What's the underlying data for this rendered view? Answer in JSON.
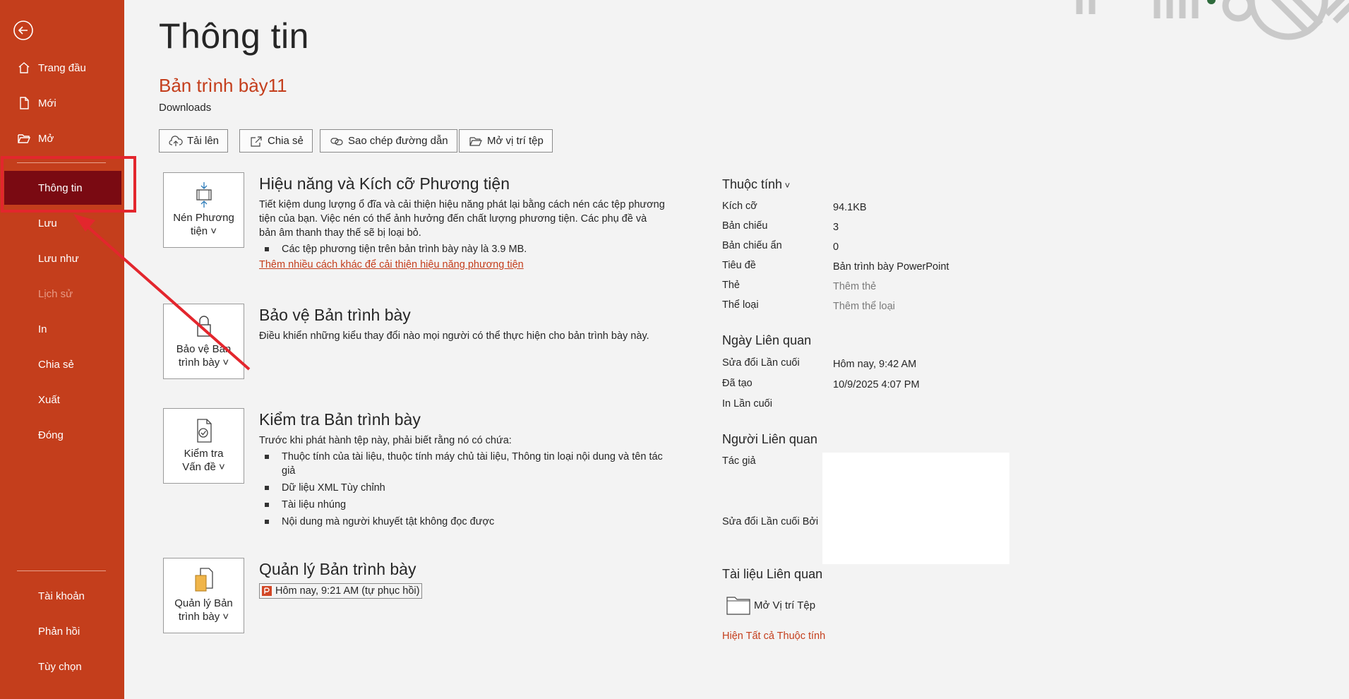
{
  "colors": {
    "sidebar": "#c43e1c",
    "sidebar_active": "#7a0a12",
    "accent": "#c43e1c",
    "highlight": "#e3262d"
  },
  "sidebar": {
    "items": [
      {
        "label": "Trang đầu",
        "icon": "home-icon"
      },
      {
        "label": "Mới",
        "icon": "new-document-icon"
      },
      {
        "label": "Mở",
        "icon": "open-folder-icon"
      },
      {
        "label": "Thông tin",
        "active": true
      },
      {
        "label": "Lưu"
      },
      {
        "label": "Lưu như"
      },
      {
        "label": "Lịch sử",
        "disabled": true
      },
      {
        "label": "In"
      },
      {
        "label": "Chia sẻ"
      },
      {
        "label": "Xuất"
      },
      {
        "label": "Đóng"
      }
    ],
    "bottom": [
      {
        "label": "Tài khoản"
      },
      {
        "label": "Phản hồi"
      },
      {
        "label": "Tùy chọn"
      }
    ]
  },
  "header": {
    "title": "Thông tin",
    "doc_title": "Bản trình bày11",
    "location": "Downloads"
  },
  "actions": [
    {
      "label": "Tải lên",
      "icon": "upload-cloud-icon"
    },
    {
      "label": "Chia sẻ",
      "icon": "share-icon"
    },
    {
      "label": "Sao chép đường dẫn",
      "icon": "link-icon"
    },
    {
      "label": "Mở vị trí tệp",
      "icon": "folder-open-icon"
    }
  ],
  "sections": {
    "media": {
      "tile_line1": "Nén Phương",
      "tile_line2": "tiện",
      "heading": "Hiệu năng và Kích cỡ Phương tiện",
      "text": "Tiết kiệm dung lượng ổ đĩa và cải thiện hiệu năng phát lại bằng cách nén các tệp phương tiện của bạn. Việc nén có thể ảnh hưởng đến chất lượng phương tiện. Các phụ đề và bản âm thanh thay thế sẽ bị loại bỏ.",
      "bullets": [
        "Các tệp phương tiện trên bản trình bày này là 3.9 MB."
      ],
      "link": "Thêm nhiều cách khác để cải thiện hiệu năng phương tiện"
    },
    "protect": {
      "tile_line1": "Bảo vệ Bản",
      "tile_line2": "trình bày",
      "heading": "Bảo vệ Bản trình bày",
      "text": "Điều khiển những kiểu thay đổi nào mọi người có thể thực hiện cho bản trình bày này."
    },
    "inspect": {
      "tile_line1": "Kiểm tra",
      "tile_line2": "Vấn đề",
      "heading": "Kiểm tra Bản trình bày",
      "text": "Trước khi phát hành tệp này, phải biết rằng nó có chứa:",
      "bullets": [
        "Thuộc tính của tài liệu, thuộc tính máy chủ tài liệu, Thông tin loại nội dung và tên tác giả",
        "Dữ liệu XML Tùy chỉnh",
        "Tài liệu nhúng",
        "Nội dung mà người khuyết tật không đọc được"
      ]
    },
    "manage": {
      "tile_line1": "Quản lý Bản",
      "tile_line2": "trình bày",
      "heading": "Quản lý Bản trình bày",
      "version": "Hôm nay, 9:21 AM (tự phục hồi)"
    }
  },
  "properties": {
    "heading": "Thuộc tính",
    "rows": [
      {
        "label": "Kích cỡ",
        "value": "94.1KB"
      },
      {
        "label": "Bản chiếu",
        "value": "3"
      },
      {
        "label": "Bản chiếu ẩn",
        "value": "0"
      },
      {
        "label": "Tiêu đề",
        "value": "Bản trình bày PowerPoint"
      },
      {
        "label": "Thẻ",
        "value": "Thêm thẻ"
      },
      {
        "label": "Thể loại",
        "value": "Thêm thể loại"
      }
    ]
  },
  "dates": {
    "heading": "Ngày Liên quan",
    "rows": [
      {
        "label": "Sửa đổi Lần cuối",
        "value": "Hôm nay, 9:42 AM"
      },
      {
        "label": "Đã tạo",
        "value": "10/9/2025 4:07 PM"
      },
      {
        "label": "In Lần cuối",
        "value": ""
      }
    ]
  },
  "people": {
    "heading": "Người Liên quan",
    "author_label": "Tác giả",
    "last_modified_label": "Sửa đổi Lần cuối Bởi"
  },
  "related_docs": {
    "heading": "Tài liệu Liên quan",
    "open_location": "Mở Vị trí Tệp"
  },
  "show_all": "Hiện Tất cả Thuộc tính"
}
